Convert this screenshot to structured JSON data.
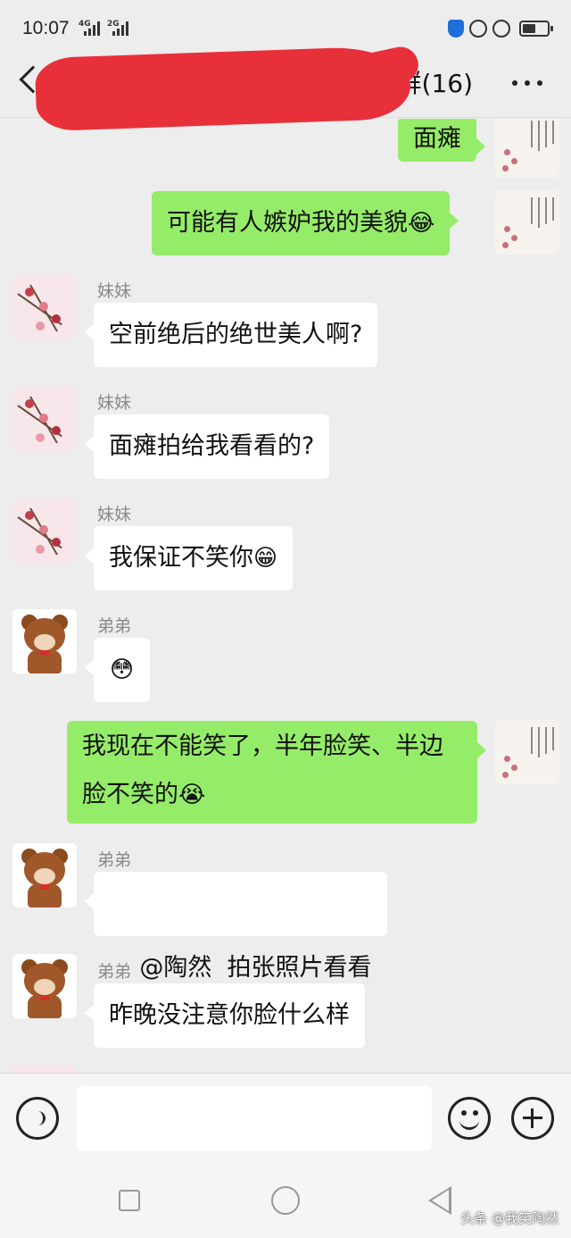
{
  "status_bar": {
    "time": "10:07",
    "signal1": "4G",
    "signal2": "2G"
  },
  "header": {
    "title_visible": "群(16)",
    "back_icon": "chevron-left-icon",
    "more_icon": "more-dots-icon"
  },
  "messages": [
    {
      "side": "out",
      "text": "面瘫"
    },
    {
      "side": "out",
      "text": "可能有人嫉妒我的美貌",
      "emoji": "😂"
    },
    {
      "side": "in",
      "sender": "妹妹",
      "text": "空前绝后的绝世美人啊?"
    },
    {
      "side": "in",
      "sender": "妹妹",
      "text": "面瘫拍给我看看的?"
    },
    {
      "side": "in",
      "sender": "妹妹",
      "text": "我保证不笑你",
      "emoji": "😁"
    },
    {
      "side": "in",
      "sender": "弟弟",
      "text": "",
      "emoji": "😳"
    },
    {
      "side": "out",
      "line1": "我现在不能笑了，半年脸笑、半边",
      "line2": "脸不笑的",
      "emoji": "😭"
    },
    {
      "side": "in",
      "sender": "弟弟",
      "text": "@陶然  拍张照片看看"
    },
    {
      "side": "in",
      "sender": "弟弟",
      "text": "昨晚没注意你脸什么样"
    }
  ],
  "input": {
    "value": ""
  },
  "watermark": "头条 @我笑陶然",
  "colors": {
    "outgoing": "#95ec69",
    "incoming": "#ffffff",
    "background": "#ededed",
    "redaction": "#e8303a"
  }
}
